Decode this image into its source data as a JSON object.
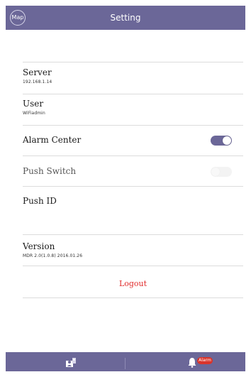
{
  "header": {
    "map_label": "Map",
    "title": "Setting"
  },
  "settings": {
    "server": {
      "label": "Server",
      "value": "192.168.1.14"
    },
    "user": {
      "label": "User",
      "value": "WiFiadmin"
    },
    "alarm_center": {
      "label": "Alarm Center",
      "enabled": true
    },
    "push_switch": {
      "label": "Push Switch",
      "enabled": false
    },
    "push_id": {
      "label": "Push ID",
      "value": ""
    },
    "version": {
      "label": "Version",
      "value": "MDR 2.0(1.0.8) 2016.01.26"
    },
    "logout_label": "Logout"
  },
  "bottom_bar": {
    "tabs": [
      {
        "icon": "contacts-icon"
      },
      {
        "icon": "bell-icon",
        "badge": "Alarm"
      }
    ]
  },
  "colors": {
    "accent": "#6b6798",
    "logout": "#e02a2a",
    "badge": "#d9342b"
  }
}
